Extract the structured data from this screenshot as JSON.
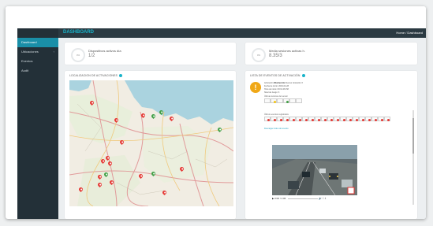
{
  "sidebar": {
    "items": [
      {
        "label": "Dashboard",
        "active": true
      },
      {
        "label": "Ubicaciones",
        "has_submenu": true
      },
      {
        "label": "Eventos"
      },
      {
        "label": "Audit"
      }
    ]
  },
  "header": {
    "title": "DASHBOARD",
    "breadcrumb": "Home / Dashboard"
  },
  "kpis": [
    {
      "percent": "0%",
      "label": "Dispositivos activos día",
      "value": "1/2"
    },
    {
      "percent": "0%",
      "label": "Media sesiones activas h.",
      "value": "8.35/3"
    }
  ],
  "map_section": {
    "title": "LOCALIZACION DE ACTIVACIONES",
    "pins": [
      {
        "color": "red"
      },
      {
        "color": "red"
      },
      {
        "color": "red"
      },
      {
        "color": "green"
      },
      {
        "color": "green"
      },
      {
        "color": "red"
      },
      {
        "color": "red"
      },
      {
        "color": "red"
      },
      {
        "color": "red"
      },
      {
        "color": "green"
      },
      {
        "color": "red"
      },
      {
        "color": "red"
      },
      {
        "color": "red"
      },
      {
        "color": "green"
      },
      {
        "color": "red"
      },
      {
        "color": "red"
      },
      {
        "color": "red"
      },
      {
        "color": "green"
      },
      {
        "color": "red"
      },
      {
        "color": "red"
      }
    ]
  },
  "events_section": {
    "title": "LISTA DE EVENTOS DE ACTIVACIÓN",
    "event": {
      "line1_prefix": "Activación ",
      "line1_bold": "Obstrucción",
      "line1_suffix": " Sensor ubicación X",
      "line2": "Fecha de inicio: 2019-04-28",
      "line3": "Hora de inicio: 09:31:46 PM",
      "line4": "Nivel de riesgo: 3"
    },
    "grid1_caption": "Últimas lecturas del sensor",
    "grid1_dots": [
      "",
      "#f5c518",
      "",
      "#43a047",
      "",
      ""
    ],
    "grid2_caption": "Últimos eventos registrados",
    "grid2_dots": [
      "#e53935",
      "#e53935",
      "#e53935",
      "#e53935",
      "#e53935",
      "#e53935",
      "#e53935",
      "#e53935",
      "#e53935",
      "#e53935",
      "#e53935",
      "#e53935",
      "#e53935",
      "#e53935",
      "#e53935",
      "#e53935",
      "#e53935",
      "#e53935",
      "#e53935",
      "#e53935"
    ],
    "link_text": "Descargar vídeo del evento",
    "video_time": "0:00 / 1:06"
  }
}
